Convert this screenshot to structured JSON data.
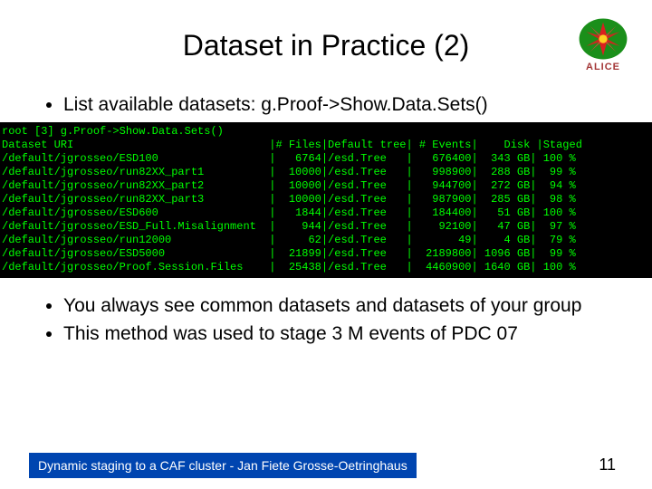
{
  "logo": {
    "label": "ALICE"
  },
  "title": "Dataset in Practice (2)",
  "bullets_top": [
    "List available datasets: g.Proof->Show.Data.Sets()"
  ],
  "terminal": {
    "prompt": "root [3] g.Proof->Show.Data.Sets()",
    "hdr": {
      "uri": "Dataset URI",
      "files": "# Files",
      "tree": "Default tree",
      "events": "# Events",
      "disk": "Disk",
      "staged": "Staged"
    },
    "rows": [
      {
        "uri": "/default/jgrosseo/ESD100",
        "files": "6764",
        "tree": "/esd.Tree",
        "events": "676400",
        "disk": "343 GB",
        "staged": "100 %"
      },
      {
        "uri": "/default/jgrosseo/run82XX_part1",
        "files": "10000",
        "tree": "/esd.Tree",
        "events": "998900",
        "disk": "288 GB",
        "staged": "99 %"
      },
      {
        "uri": "/default/jgrosseo/run82XX_part2",
        "files": "10000",
        "tree": "/esd.Tree",
        "events": "944700",
        "disk": "272 GB",
        "staged": "94 %"
      },
      {
        "uri": "/default/jgrosseo/run82XX_part3",
        "files": "10000",
        "tree": "/esd.Tree",
        "events": "987900",
        "disk": "285 GB",
        "staged": "98 %"
      },
      {
        "uri": "/default/jgrosseo/ESD600",
        "files": "1844",
        "tree": "/esd.Tree",
        "events": "184400",
        "disk": "51 GB",
        "staged": "100 %"
      },
      {
        "uri": "/default/jgrosseo/ESD_Full.Misalignment",
        "files": "944",
        "tree": "/esd.Tree",
        "events": "92100",
        "disk": "47 GB",
        "staged": "97 %"
      },
      {
        "uri": "/default/jgrosseo/run12000",
        "files": "62",
        "tree": "/esd.Tree",
        "events": "49",
        "disk": "4 GB",
        "staged": "79 %"
      },
      {
        "uri": "/default/jgrosseo/ESD5000",
        "files": "21899",
        "tree": "/esd.Tree",
        "events": "2189800",
        "disk": "1096 GB",
        "staged": "99 %"
      },
      {
        "uri": "/default/jgrosseo/Proof.Session.Files",
        "files": "25438",
        "tree": "/esd.Tree",
        "events": "4460900",
        "disk": "1640 GB",
        "staged": "100 %"
      }
    ]
  },
  "bullets_bottom": [
    "You always see common datasets and datasets of your group",
    "This method was used to stage 3 M events of PDC 07"
  ],
  "footer": {
    "text": "Dynamic staging to a CAF cluster - Jan Fiete Grosse-Oetringhaus",
    "page": "11"
  }
}
